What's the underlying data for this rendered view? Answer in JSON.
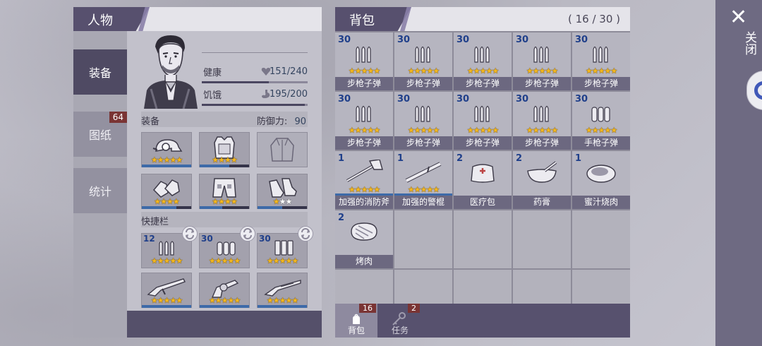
{
  "character": {
    "title": "人物",
    "tabs": [
      {
        "label": "装备",
        "active": true
      },
      {
        "label": "图纸",
        "badge": "64"
      },
      {
        "label": "统计"
      }
    ],
    "stats": [
      {
        "label": "健康",
        "value": "151/240",
        "icon": "heart-icon",
        "ratio": 0.63
      },
      {
        "label": "饥饿",
        "value": "195/200",
        "icon": "stomach-icon",
        "ratio": 0.975
      }
    ],
    "equipment_label": "装备",
    "defense_label": "防御力:",
    "defense_value": "90",
    "equipment": [
      {
        "item": "helmet",
        "stars": 5,
        "white_stars": 0,
        "durability": 1.0
      },
      {
        "item": "armor-vest",
        "stars": 4,
        "white_stars": 0,
        "durability": 0.6
      },
      {
        "item": "jacket",
        "stars": 0,
        "white_stars": 0,
        "durability": 0
      },
      {
        "item": "gloves",
        "stars": 4,
        "white_stars": 0,
        "durability": 0.7
      },
      {
        "item": "shorts",
        "stars": 4,
        "white_stars": 0,
        "durability": 0.45
      },
      {
        "item": "shoes",
        "stars": 1,
        "white_stars": 2,
        "durability": 0.5
      }
    ],
    "hotbar_label": "快捷栏",
    "hotbar": [
      {
        "item": "rifle-ammo",
        "qty": "12",
        "stars": 5,
        "swap": true
      },
      {
        "item": "pistol-ammo",
        "qty": "30",
        "stars": 5,
        "swap": true
      },
      {
        "item": "rifle-ammo",
        "qty": "30",
        "stars": 5,
        "swap": true
      },
      {
        "item": "rifle",
        "stars": 5
      },
      {
        "item": "pistol",
        "stars": 5
      },
      {
        "item": "shotgun",
        "stars": 5
      }
    ]
  },
  "backpack": {
    "title": "背包",
    "capacity": "( 16 / 30 )",
    "items": [
      {
        "name": "步枪子弹",
        "qty": "30",
        "icon": "rifle-ammo",
        "stars": 5
      },
      {
        "name": "步枪子弹",
        "qty": "30",
        "icon": "rifle-ammo",
        "stars": 5
      },
      {
        "name": "步枪子弹",
        "qty": "30",
        "icon": "rifle-ammo",
        "stars": 5
      },
      {
        "name": "步枪子弹",
        "qty": "30",
        "icon": "rifle-ammo",
        "stars": 5
      },
      {
        "name": "步枪子弹",
        "qty": "30",
        "icon": "rifle-ammo",
        "stars": 5
      },
      {
        "name": "步枪子弹",
        "qty": "30",
        "icon": "rifle-ammo",
        "stars": 5
      },
      {
        "name": "步枪子弹",
        "qty": "30",
        "icon": "rifle-ammo",
        "stars": 5
      },
      {
        "name": "步枪子弹",
        "qty": "30",
        "icon": "rifle-ammo",
        "stars": 5
      },
      {
        "name": "步枪子弹",
        "qty": "30",
        "icon": "rifle-ammo",
        "stars": 5
      },
      {
        "name": "手枪子弹",
        "qty": "30",
        "icon": "pistol-ammo",
        "stars": 5
      },
      {
        "name": "加强的消防斧",
        "qty": "1",
        "icon": "fire-axe",
        "stars": 5,
        "bar": true
      },
      {
        "name": "加强的警棍",
        "qty": "1",
        "icon": "baton",
        "stars": 5,
        "bar": true
      },
      {
        "name": "医疗包",
        "qty": "2",
        "icon": "medkit"
      },
      {
        "name": "药膏",
        "qty": "2",
        "icon": "ointment"
      },
      {
        "name": "蜜汁烧肉",
        "qty": "1",
        "icon": "honey-meat"
      },
      {
        "name": "烤肉",
        "qty": "2",
        "icon": "roast-meat"
      }
    ],
    "total_slots": 25,
    "footer_tabs": [
      {
        "label": "背包",
        "badge": "16",
        "icon": "backpack-icon",
        "active": true
      },
      {
        "label": "任务",
        "badge": "2",
        "icon": "key-icon"
      }
    ]
  },
  "close": {
    "label": "关闭"
  }
}
